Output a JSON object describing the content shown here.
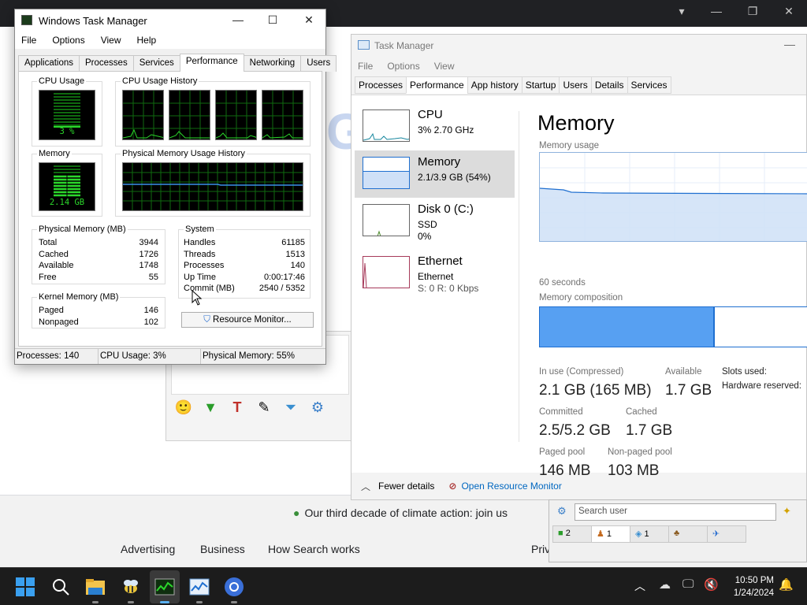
{
  "background": {
    "climate_text": "Our third decade of climate action: join us",
    "footer_links": [
      "Advertising",
      "Business",
      "How Search works",
      "Priv"
    ],
    "search_hint": "Search"
  },
  "classic_tm": {
    "title": "Windows Task Manager",
    "menu": [
      "File",
      "Options",
      "View",
      "Help"
    ],
    "tabs": [
      "Applications",
      "Processes",
      "Services",
      "Performance",
      "Networking",
      "Users"
    ],
    "active_tab": "Performance",
    "cpu_usage_label": "CPU Usage",
    "cpu_usage_value": "3 %",
    "cpu_history_label": "CPU Usage History",
    "memory_label": "Memory",
    "memory_value": "2.14 GB",
    "phys_history_label": "Physical Memory Usage History",
    "physical_memory": {
      "label": "Physical Memory (MB)",
      "rows": [
        [
          "Total",
          "3944"
        ],
        [
          "Cached",
          "1726"
        ],
        [
          "Available",
          "1748"
        ],
        [
          "Free",
          "55"
        ]
      ]
    },
    "system": {
      "label": "System",
      "rows": [
        [
          "Handles",
          "61185"
        ],
        [
          "Threads",
          "1513"
        ],
        [
          "Processes",
          "140"
        ],
        [
          "Up Time",
          "0:00:17:46"
        ],
        [
          "Commit (MB)",
          "2540 / 5352"
        ]
      ]
    },
    "kernel_memory": {
      "label": "Kernel Memory (MB)",
      "rows": [
        [
          "Paged",
          "146"
        ],
        [
          "Nonpaged",
          "102"
        ]
      ]
    },
    "resource_monitor_label": "Resource Monitor...",
    "status": {
      "processes": "Processes: 140",
      "cpu": "CPU Usage: 3%",
      "memory": "Physical Memory: 55%"
    }
  },
  "modern_tm": {
    "title": "Task Manager",
    "menu": [
      "File",
      "Options",
      "View"
    ],
    "tabs": [
      "Processes",
      "Performance",
      "App history",
      "Startup",
      "Users",
      "Details",
      "Services"
    ],
    "active_tab": "Performance",
    "resources": [
      {
        "name": "CPU",
        "line1": "3%  2.70 GHz",
        "line2": ""
      },
      {
        "name": "Memory",
        "line1": "2.1/3.9 GB (54%)",
        "line2": ""
      },
      {
        "name": "Disk 0 (C:)",
        "line1": "SSD",
        "line2": "0%"
      },
      {
        "name": "Ethernet",
        "line1": "Ethernet",
        "line2": "S: 0  R: 0 Kbps"
      }
    ],
    "detail": {
      "title": "Memory",
      "usage_label": "Memory usage",
      "time_label": "60 seconds",
      "composition_label": "Memory composition",
      "in_use_label": "In use (Compressed)",
      "in_use_value": "2.1 GB (165 MB)",
      "available_label": "Available",
      "available_value": "1.7 GB",
      "slots_label": "Slots used:",
      "hw_reserved_label": "Hardware reserved:",
      "committed_label": "Committed",
      "committed_value": "2.5/5.2 GB",
      "cached_label": "Cached",
      "cached_value": "1.7 GB",
      "paged_label": "Paged pool",
      "paged_value": "146 MB",
      "nonpaged_label": "Non-paged pool",
      "nonpaged_value": "103 MB",
      "usage_fraction": 0.54
    },
    "fewer_details": "Fewer details",
    "open_resmon": "Open Resource Monitor"
  },
  "chat": {
    "search_placeholder": "Search user",
    "tabs": [
      "2",
      "1",
      "1",
      "",
      ""
    ]
  },
  "taskbar": {
    "time": "10:50 PM",
    "date": "1/24/2024"
  },
  "colors": {
    "meter_green": "#2bd82b",
    "mem_fill": "#cfe0f7",
    "mem_line": "#1f6fd0",
    "accent": "#0067c0"
  }
}
